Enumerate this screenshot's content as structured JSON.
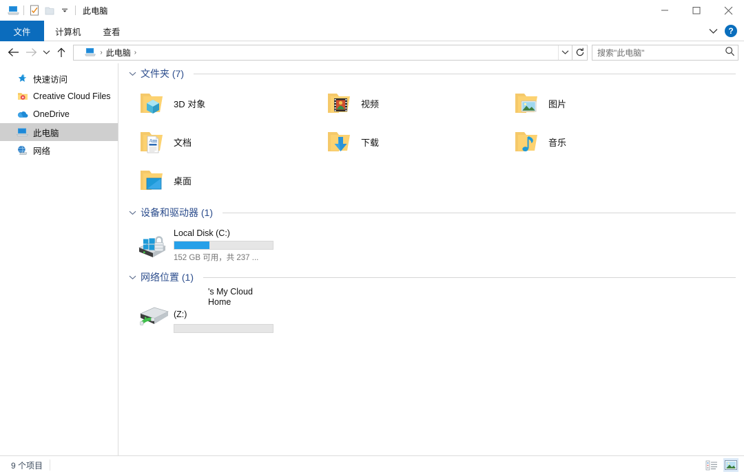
{
  "window": {
    "title": "此电脑",
    "quick_access_toolbar": [
      {
        "name": "this-pc-icon",
        "label": "此电脑"
      },
      {
        "name": "properties-icon",
        "label": "属性"
      },
      {
        "name": "new-folder-icon",
        "label": "新建文件夹"
      },
      {
        "name": "customize-dropdown-icon",
        "label": "自定义快速访问工具栏"
      }
    ],
    "controls": {
      "minimize": "最小化",
      "maximize": "最大化",
      "close": "关闭"
    }
  },
  "ribbon": {
    "tabs": [
      {
        "label": "文件",
        "active": true
      },
      {
        "label": "计算机",
        "active": false
      },
      {
        "label": "查看",
        "active": false
      }
    ],
    "expand_label": "展开功能区",
    "help_label": "?"
  },
  "address": {
    "back_label": "后退",
    "forward_label": "前进",
    "recent_label": "最近浏览的位置",
    "up_label": "上移到上一级",
    "breadcrumb": [
      {
        "icon": "this-pc-icon",
        "label": "此电脑"
      }
    ],
    "breadcrumb_sep": "›",
    "dropdown_label": "上一个位置",
    "refresh_label": "刷新",
    "search_placeholder": "搜索\"此电脑\""
  },
  "sidebar": {
    "items": [
      {
        "label": "快速访问",
        "icon": "pin-star-icon",
        "selected": false
      },
      {
        "label": "Creative Cloud Files",
        "icon": "creative-cloud-folder-icon",
        "selected": false
      },
      {
        "label": "OneDrive",
        "icon": "onedrive-cloud-icon",
        "selected": false
      },
      {
        "label": "此电脑",
        "icon": "this-pc-icon",
        "selected": true
      },
      {
        "label": "网络",
        "icon": "network-icon",
        "selected": false
      }
    ]
  },
  "main": {
    "groups": [
      {
        "id": "folders",
        "title": "文件夹 (7)",
        "expanded": true,
        "items": [
          {
            "label": "3D 对象",
            "icon": "folder-3d-objects-icon"
          },
          {
            "label": "视频",
            "icon": "folder-videos-icon"
          },
          {
            "label": "图片",
            "icon": "folder-pictures-icon"
          },
          {
            "label": "文档",
            "icon": "folder-documents-icon"
          },
          {
            "label": "下载",
            "icon": "folder-downloads-icon"
          },
          {
            "label": "音乐",
            "icon": "folder-music-icon"
          },
          {
            "label": "桌面",
            "icon": "folder-desktop-icon"
          }
        ]
      },
      {
        "id": "devices",
        "title": "设备和驱动器 (1)",
        "expanded": true,
        "drives": [
          {
            "name": "Local Disk (C:)",
            "icon": "system-drive-bitlocker-icon",
            "free_text": "152 GB 可用，共 237 ...",
            "used_percent": 36,
            "bar_color": "#27a0e8",
            "show_bar": true
          }
        ]
      },
      {
        "id": "network",
        "title": "网络位置 (1)",
        "expanded": true,
        "drives": [
          {
            "name": "'s My Cloud Home (Z:)",
            "name_line1": "'s My Cloud Home",
            "name_line2": "(Z:)",
            "icon": "network-drive-icon",
            "free_text": "",
            "used_percent": 0,
            "bar_color": "#e6e6e6",
            "show_bar": true
          }
        ]
      }
    ]
  },
  "status": {
    "item_count": "9 个项目",
    "views": [
      {
        "name": "details-view-button",
        "label": "详细信息",
        "active": false
      },
      {
        "name": "large-icons-view-button",
        "label": "大图标",
        "active": true
      }
    ]
  },
  "colors": {
    "accent_tab": "#0b6cbd",
    "group_title": "#2b4c8c",
    "selection": "#cfcfcf",
    "bar_fill": "#27a0e8",
    "help_blue": "#0a6ebd"
  }
}
